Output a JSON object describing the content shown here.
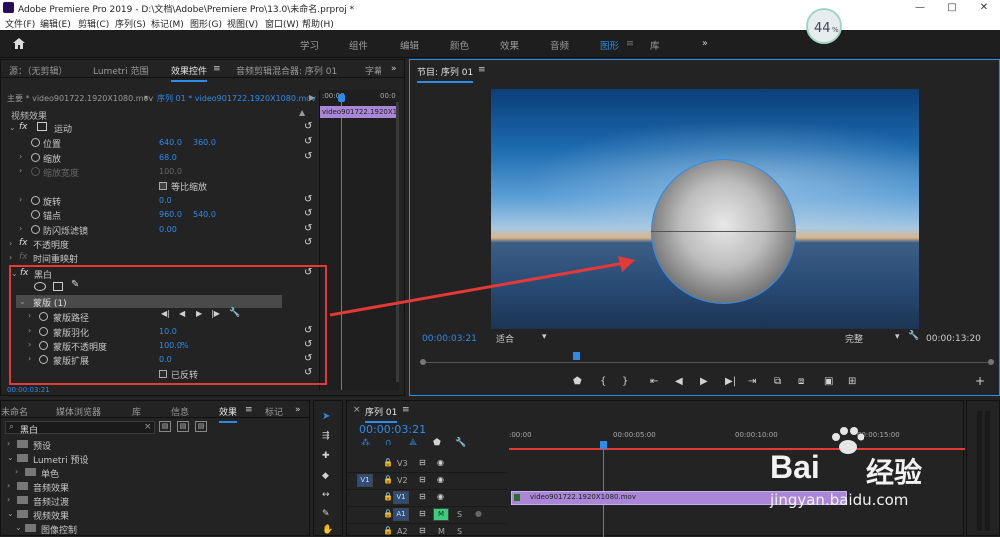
{
  "window": {
    "title": "Adobe Premiere Pro 2019 - D:\\文档\\Adobe\\Premiere Pro\\13.0\\未命名.prproj *",
    "min": "—",
    "max": "□",
    "close": "✕"
  },
  "menu": [
    "文件(F)",
    "编辑(E)",
    "剪辑(C)",
    "序列(S)",
    "标记(M)",
    "图形(G)",
    "视图(V)",
    "窗口(W)",
    "帮助(H)"
  ],
  "workspaces": [
    "学习",
    "组件",
    "编辑",
    "颜色",
    "效果",
    "音频",
    "图形",
    "库"
  ],
  "workspace_active": "图形",
  "workspace_more": "»",
  "progress": {
    "value": "44",
    "unit": "%"
  },
  "source_panel": {
    "tabs": [
      "源：（无剪辑）",
      "Lumetri 范围",
      "效果控件",
      "音频剪辑混合器: 序列 01",
      "字幕"
    ],
    "active_tab": "效果控件",
    "menu_icon": "≡",
    "more": "»"
  },
  "effect_controls": {
    "master": "主要 * video901722.1920X1080.mov",
    "sequence_clip": "序列 01 * video901722.1920X1080.mov",
    "timeline_start": ":00:00",
    "timeline_end": "00:0",
    "clip_label": "video901722.1920X10",
    "section": "视频效果",
    "motion": "运动",
    "position": {
      "label": "位置",
      "x": "640.0",
      "y": "360.0"
    },
    "scale": {
      "label": "缩放",
      "value": "68.0"
    },
    "scale_width": {
      "label": "缩放宽度",
      "value": "100.0"
    },
    "uniform_scale": "等比缩放",
    "rotation": {
      "label": "旋转",
      "value": "0.0"
    },
    "anchor": {
      "label": "锚点",
      "x": "960.0",
      "y": "540.0"
    },
    "antiflicker": {
      "label": "防闪烁滤镜",
      "value": "0.00"
    },
    "opacity": "不透明度",
    "time_remap": "时间重映射",
    "bw": "黑白",
    "mask": "蒙版 (1)",
    "mask_path": "蒙版路径",
    "mask_feather": {
      "label": "蒙版羽化",
      "value": "10.0"
    },
    "mask_opacity": {
      "label": "蒙版不透明度",
      "value": "100.0",
      "unit": "%"
    },
    "mask_expand": {
      "label": "蒙版扩展",
      "value": "0.0"
    },
    "inverted": "已反转",
    "timecode": "00:00:03:21",
    "fx": "fx",
    "reset": "↺"
  },
  "program": {
    "tab": "节目: 序列 01",
    "menu_icon": "≡",
    "timecode": "00:00:03:21",
    "fit": "适合",
    "quality": "完整",
    "duration": "00:00:13:20",
    "add": "+"
  },
  "project_panel": {
    "tabs": [
      "未命名",
      "媒体浏览器",
      "库",
      "信息",
      "效果",
      "标记"
    ],
    "active_tab": "效果",
    "menu_icon": "≡",
    "more": "»",
    "search": "黑白",
    "tree": [
      "预设",
      "Lumetri 预设",
      "单色",
      "音频效果",
      "音频过渡",
      "视频效果",
      "图像控制"
    ]
  },
  "timeline": {
    "tab": "序列 01",
    "menu_icon": "≡",
    "close": "×",
    "timecode": "00:00:03:21",
    "ruler": [
      ":00:00",
      "00:00:05:00",
      "00:00:10:00",
      "00:00:15:00"
    ],
    "tracks": [
      {
        "name": "V3"
      },
      {
        "name": "V2"
      },
      {
        "name": "V1",
        "src": "V1"
      },
      {
        "name": "A1",
        "m": "M",
        "s": "S"
      },
      {
        "name": "A2",
        "m": "M",
        "s": "S"
      }
    ],
    "clip": "video901722.1920X1080.mov"
  },
  "watermark": {
    "brand_left": "Bai",
    "brand_right": "经验",
    "url": "jingyan.baidu.com"
  },
  "colors": {
    "accent": "#2d8ceb",
    "clip": "#a987d6",
    "annotation": "#e53935",
    "title_bar": "#ffffff"
  }
}
